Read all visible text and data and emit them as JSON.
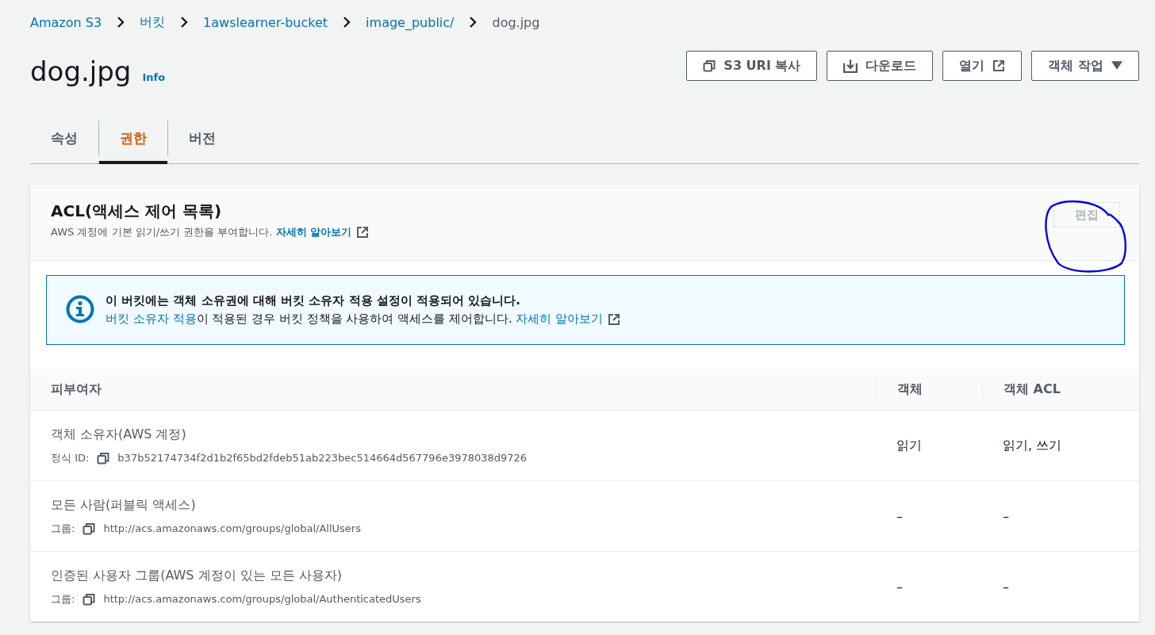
{
  "breadcrumbs": [
    {
      "label": "Amazon S3",
      "link": true
    },
    {
      "label": "버킷",
      "link": true
    },
    {
      "label": "1awslearner-bucket",
      "link": true
    },
    {
      "label": "image_public/",
      "link": true
    },
    {
      "label": "dog.jpg",
      "link": false
    }
  ],
  "title": "dog.jpg",
  "info_link": "Info",
  "actions": [
    {
      "label": "S3 URI 복사",
      "kind": "copy"
    },
    {
      "label": "다운로드",
      "kind": "download"
    },
    {
      "label": "열기",
      "kind": "external"
    },
    {
      "label": "객체 작업",
      "kind": "dropdown"
    }
  ],
  "tabs": [
    {
      "label": "속성",
      "selected": false
    },
    {
      "label": "권한",
      "selected": true
    },
    {
      "label": "버전",
      "selected": false
    }
  ],
  "acl": {
    "title": "ACL(액세스 제어 목록)",
    "description": "AWS 계정에 기본 읽기/쓰기 권한을 부여합니다.",
    "learn_more": "자세히 알아보기",
    "edit_button": {
      "label": "편집",
      "disabled": true
    },
    "notice": {
      "title": "이 버킷에는 객체 소유권에 대해 버킷 소유자 적용 설정이 적용되어 있습니다.",
      "link": "버킷 소유자 적용",
      "text": "이 적용된 경우 버킷 정책을 사용하여 액세스를 제어합니다.",
      "learn_more": "자세히 알아보기"
    },
    "table": {
      "columns": [
        "피부여자",
        "객체",
        "객체 ACL"
      ],
      "rows": [
        {
          "grantee": "객체 소유자(AWS 계정)",
          "id_label": "정식 ID:",
          "id_value": "b37b52174734f2d1b2f65bd2fdeb51ab223bec514664d567796e3978038d9726",
          "object": "읽기",
          "object_acl": "읽기, 쓰기"
        },
        {
          "grantee": "모든 사람(퍼블릭 액세스)",
          "id_label": "그룹:",
          "id_value": "http://acs.amazonaws.com/groups/global/AllUsers",
          "object": "–",
          "object_acl": "–"
        },
        {
          "grantee": "인증된 사용자 그룹(AWS 계정이 있는 모든 사용자)",
          "id_label": "그룹:",
          "id_value": "http://acs.amazonaws.com/groups/global/AuthenticatedUsers",
          "object": "–",
          "object_acl": "–"
        }
      ]
    }
  }
}
